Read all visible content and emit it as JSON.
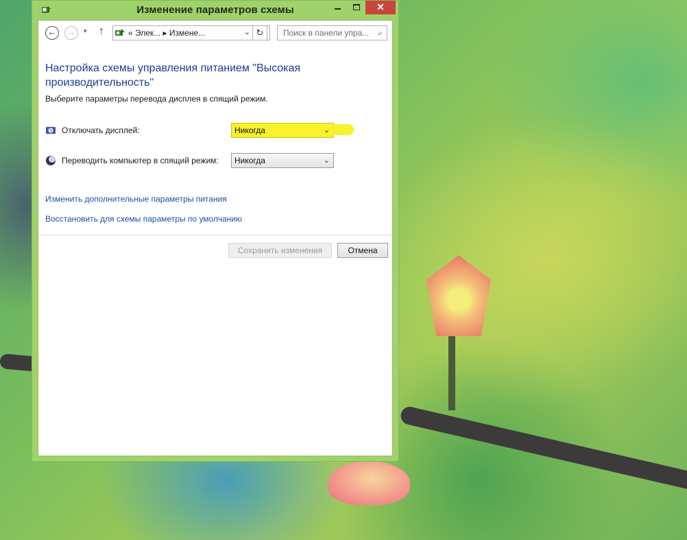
{
  "window": {
    "title": "Изменение параметров схемы",
    "controls": {
      "minimize": "",
      "maximize": "",
      "close": "✕"
    }
  },
  "navbar": {
    "back_glyph": "←",
    "forward_glyph": "→",
    "dropdown_glyph": "▾",
    "up_glyph": "↑",
    "address": "«  Элек...  ▸  Измене...",
    "address_dropdown_glyph": "⌄",
    "refresh_glyph": "↻",
    "search_placeholder": "Поиск в панели упра...",
    "search_icon_glyph": "⌕"
  },
  "content": {
    "heading": "Настройка схемы управления питанием \"Высокая производительность\"",
    "subtext": "Выберите параметры перевода дисплея в спящий режим.",
    "settings": [
      {
        "label": "Отключать дисплей:",
        "value": "Никогда",
        "icon": "display-icon"
      },
      {
        "label": "Переводить компьютер в спящий режим:",
        "value": "Никогда",
        "icon": "sleep-moon-icon"
      }
    ],
    "select_arrow": "⌄",
    "links": [
      "Изменить дополнительные параметры питания",
      "Восстановить для схемы параметры по умолчанию"
    ]
  },
  "buttons": {
    "save": "Сохранить изменения",
    "cancel": "Отмена"
  },
  "colors": {
    "window_frame": "#9fd26a",
    "close_button": "#c7463a",
    "heading_text": "#1e3b94",
    "link_text": "#1c4ea8",
    "highlight": "#f7f22a"
  }
}
